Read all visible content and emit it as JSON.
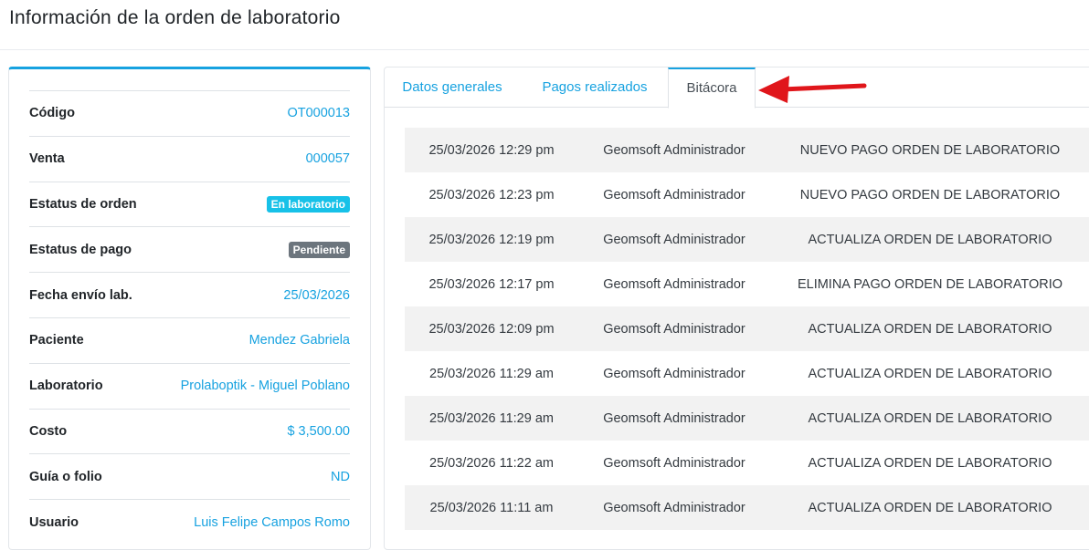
{
  "page": {
    "title": "Información de la orden de laboratorio"
  },
  "info": {
    "rows": [
      {
        "label": "Código",
        "value": "OT000013"
      },
      {
        "label": "Venta",
        "value": "000057"
      },
      {
        "label": "Estatus de orden",
        "badge": "En laboratorio"
      },
      {
        "label": "Estatus de pago",
        "badge": "Pendiente"
      },
      {
        "label": "Fecha envío lab.",
        "value": "25/03/2026"
      },
      {
        "label": "Paciente",
        "value": "Mendez Gabriela"
      },
      {
        "label": "Laboratorio",
        "value": "Prolaboptik - Miguel Poblano"
      },
      {
        "label": "Costo",
        "value": "$ 3,500.00"
      },
      {
        "label": "Guía o folio",
        "value": "ND"
      },
      {
        "label": "Usuario",
        "value": "Luis Felipe Campos Romo"
      }
    ]
  },
  "tabs": [
    {
      "label": "Datos generales"
    },
    {
      "label": "Pagos realizados"
    },
    {
      "label": "Bitácora"
    }
  ],
  "log": [
    {
      "date": "25/03/2026 12:29 pm",
      "user": "Geomsoft Administrador",
      "action": "NUEVO PAGO ORDEN DE LABORATORIO"
    },
    {
      "date": "25/03/2026 12:23 pm",
      "user": "Geomsoft Administrador",
      "action": "NUEVO PAGO ORDEN DE LABORATORIO"
    },
    {
      "date": "25/03/2026 12:19 pm",
      "user": "Geomsoft Administrador",
      "action": "ACTUALIZA ORDEN DE LABORATORIO"
    },
    {
      "date": "25/03/2026 12:17 pm",
      "user": "Geomsoft Administrador",
      "action": "ELIMINA PAGO ORDEN DE LABORATORIO"
    },
    {
      "date": "25/03/2026 12:09 pm",
      "user": "Geomsoft Administrador",
      "action": "ACTUALIZA ORDEN DE LABORATORIO"
    },
    {
      "date": "25/03/2026 11:29 am",
      "user": "Geomsoft Administrador",
      "action": "ACTUALIZA ORDEN DE LABORATORIO"
    },
    {
      "date": "25/03/2026 11:29 am",
      "user": "Geomsoft Administrador",
      "action": "ACTUALIZA ORDEN DE LABORATORIO"
    },
    {
      "date": "25/03/2026 11:22 am",
      "user": "Geomsoft Administrador",
      "action": "ACTUALIZA ORDEN DE LABORATORIO"
    },
    {
      "date": "25/03/2026 11:11 am",
      "user": "Geomsoft Administrador",
      "action": "ACTUALIZA ORDEN DE LABORATORIO"
    }
  ],
  "colors": {
    "accent": "#17a2e0",
    "badge_info": "#17c1e8",
    "badge_secondary": "#6c757d",
    "arrow": "#e0161b"
  },
  "annotation": {
    "icon": "red-arrow-icon"
  }
}
